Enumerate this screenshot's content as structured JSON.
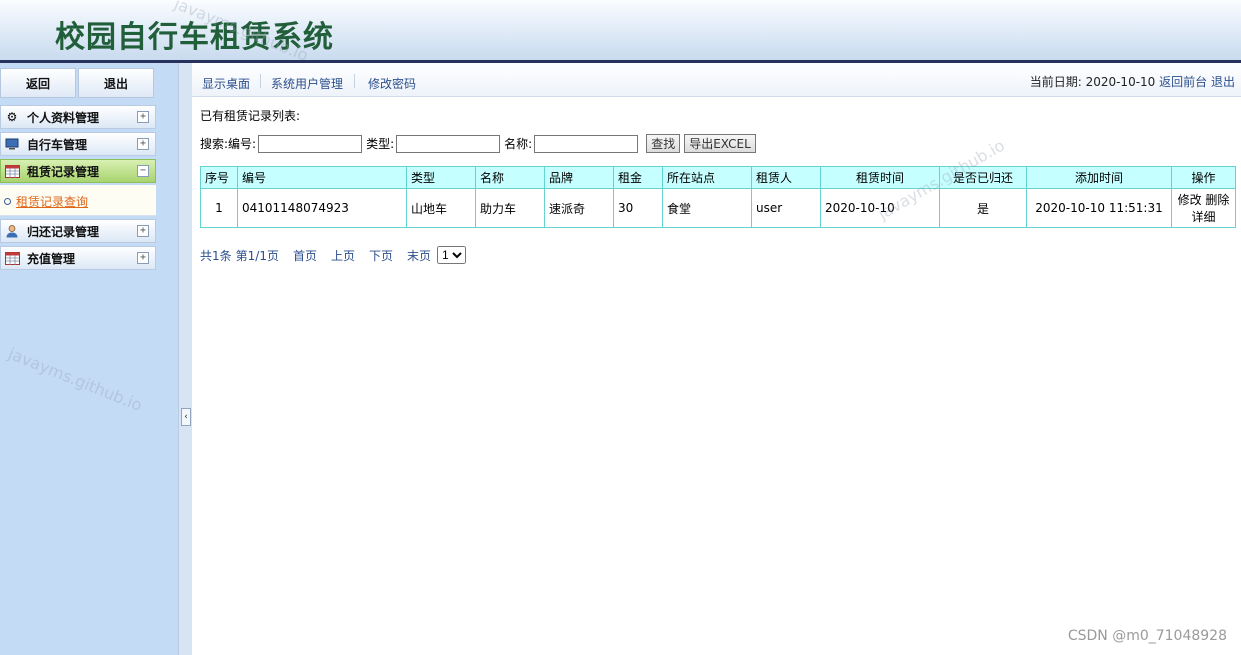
{
  "app": {
    "title": "校园自行车租赁系统"
  },
  "sidebar": {
    "back_label": "返回",
    "logout_label": "退出",
    "menu": [
      {
        "label": "个人资料管理",
        "icon": "gear-icon",
        "toggle": "+"
      },
      {
        "label": "自行车管理",
        "icon": "monitor-icon",
        "toggle": "+"
      },
      {
        "label": "租赁记录管理",
        "icon": "calendar-icon",
        "toggle": "−",
        "active": true
      },
      {
        "label": "归还记录管理",
        "icon": "user-icon",
        "toggle": "+"
      },
      {
        "label": "充值管理",
        "icon": "calendar-icon",
        "toggle": "+"
      }
    ],
    "submenu": [
      {
        "label": "租赁记录查询"
      }
    ]
  },
  "topnav": {
    "links": [
      "显示桌面",
      "系统用户管理",
      "修改密码"
    ],
    "date_label": "当前日期:",
    "date_value": "2020-10-10",
    "back_front": "返回前台",
    "logout": "退出"
  },
  "main": {
    "list_title": "已有租赁记录列表:",
    "search": {
      "label": "搜索:",
      "code_label": "编号:",
      "type_label": "类型:",
      "name_label": "名称:",
      "code_value": "",
      "type_value": "",
      "name_value": "",
      "search_button": "查找",
      "export_button": "导出EXCEL"
    },
    "table": {
      "headers": [
        "序号",
        "编号",
        "类型",
        "名称",
        "品牌",
        "租金",
        "所在站点",
        "租赁人",
        "租赁时间",
        "是否已归还",
        "添加时间",
        "操作"
      ],
      "rows": [
        [
          "1",
          "04101148074923",
          "山地车",
          "助力车",
          "速派奇",
          "30",
          "食堂",
          "user",
          "2020-10-10",
          "是",
          "2020-10-10 11:51:31"
        ]
      ],
      "actions": {
        "edit": "修改",
        "delete": "删除",
        "detail": "详细"
      }
    },
    "pager": {
      "total": "共1条",
      "page": "第1/1页",
      "first": "首页",
      "prev": "上页",
      "next": "下页",
      "last": "末页",
      "select_value": "1"
    }
  },
  "watermark": "javayms.github.io",
  "footer_credit": "CSDN @m0_71048928"
}
